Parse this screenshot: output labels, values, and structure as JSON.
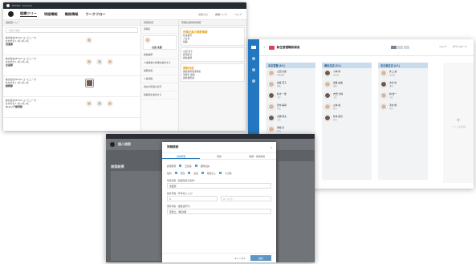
{
  "screen1": {
    "app_title": "MITSUI Fudosan",
    "nav_tabs": [
      "組織ツリー",
      "明細情報",
      "職務情報",
      "ワークフロー"
    ],
    "nav_right": [
      "お知らせ",
      "各種リンク",
      "ヘルプ"
    ],
    "left_header": "組織図ツリー",
    "search_placeholder": "名前で検索",
    "rows": [
      {
        "line1": "株式会社MITSUI コンピュータ",
        "line2": "社内分室 1 1名 2名 1名",
        "bold": "営業部"
      },
      {
        "line1": "株式会社MITSUI コンピュータ",
        "line2": "社内分室 1 1名 2名 1名",
        "bold": "企画部"
      },
      {
        "line1": "株式会社MITSUI コンピュータ",
        "line2": "社内分室 1 1名 2名 1名",
        "bold": "総務部"
      },
      {
        "line1": "株式会社MITSUI コンピュータ",
        "line2": "社内分室 1 1名 2名 1名",
        "bold": "キャリア開発部"
      }
    ],
    "mid_header": "所属情報",
    "mid_items": [
      "部署名",
      "山田 太郎",
      "異動履歴",
      "人事異動の詳細を確認する",
      "兼務情報",
      "人事評価",
      "過去の所属を表示",
      "組織図を確認する"
    ],
    "right_header": "所属社員情報詳細",
    "right_orange": "所属社員の異動情報",
    "right_items": [
      "社員番号",
      "入社日",
      "役職",
      "山田 花子",
      "雇用区分",
      "異動履歴"
    ],
    "right_orange2": "異動内容",
    "right_items2": [
      "異動前所属部署名",
      "部署名 異動",
      "異動後所属"
    ]
  },
  "screen2": {
    "title": "新任管理職候補者",
    "header_btns": [
      "ヘルプ",
      "ダウンロード"
    ],
    "columns": [
      {
        "name": "本店営業 (8人)",
        "people": [
          {
            "name": "山田 太郎",
            "role": "営業部長"
          },
          {
            "name": "佐藤 花子",
            "role": "課長"
          },
          {
            "name": "鈴木 一郎",
            "role": "主任"
          },
          {
            "name": "田中 美咲",
            "role": "係長"
          },
          {
            "name": "高橋 健太",
            "role": "主任"
          },
          {
            "name": "伊藤 恵",
            "role": "担当"
          },
          {
            "name": "渡辺 翔",
            "role": "担当"
          },
          {
            "name": "中村 愛",
            "role": "担当"
          }
        ]
      },
      {
        "name": "横浜支店 (5人)",
        "people": [
          {
            "name": "小林 修",
            "role": "支店長"
          },
          {
            "name": "加藤 由美",
            "role": "課長"
          },
          {
            "name": "吉田 大輔",
            "role": "主任"
          },
          {
            "name": "山本 綾",
            "role": "担当"
          },
          {
            "name": "松本 拓也",
            "role": "担当"
          }
        ]
      },
      {
        "name": "名古屋支店 (4人)",
        "people": [
          {
            "name": "井上 誠",
            "role": "支店長"
          },
          {
            "name": "木村 彩",
            "role": "課長"
          },
          {
            "name": "林 健一",
            "role": "主任"
          },
          {
            "name": "清水 優",
            "role": "担当"
          }
        ]
      }
    ],
    "add_column": "リストを追加"
  },
  "screen3": {
    "bg_title": "個人検索",
    "bg_section": "検索結果",
    "modal_title": "詳細検索",
    "tabs": [
      "基本項目",
      "所属",
      "職務・資格情報"
    ],
    "row1_label": "雇用形態",
    "row1_opts": [
      "正社員",
      "契約社員"
    ],
    "row2_label": "性別",
    "row2_opts": [
      "男性",
      "女性",
      "指定なし",
      "その他"
    ],
    "field1_label": "所属部署（組織階層を選択）",
    "field1_value": "営業部",
    "field2_label": "勤続年数（年単位で入力）",
    "field2_value": "3",
    "field2_placeholder": "10（以下）",
    "field3_label": "保有資格（複数選択可）",
    "field3_value": "宅建士、簿記2級",
    "cancel": "キャンセル",
    "submit": "検索"
  }
}
